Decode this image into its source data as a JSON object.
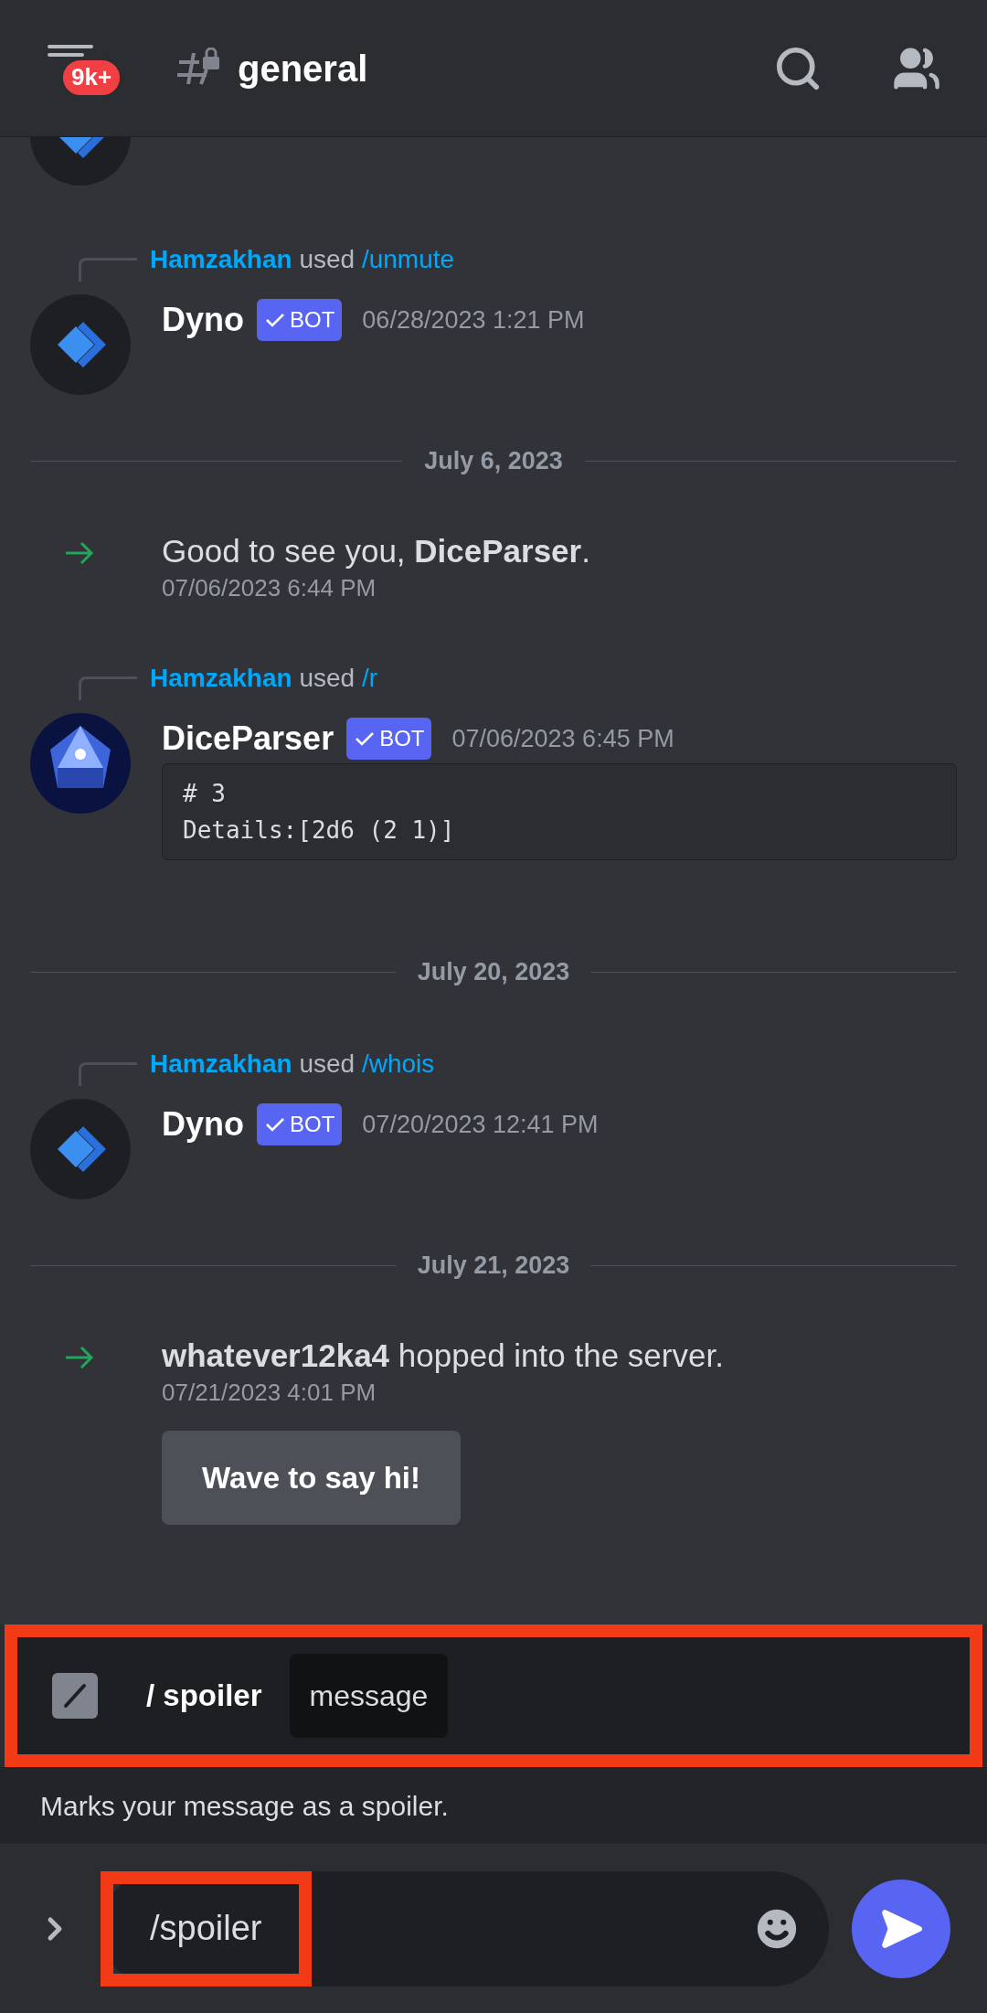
{
  "header": {
    "badge": "9k+",
    "channel": "general"
  },
  "messages": [
    {
      "kind": "cut_avatar",
      "avatar": {
        "kind": "dyno"
      }
    },
    {
      "kind": "command",
      "user": "Hamzakhan",
      "verb": "used",
      "command": "/unmute",
      "author": "Dyno",
      "avatar": {
        "kind": "dyno"
      },
      "tag": "BOT",
      "time": "06/28/2023 1:21 PM"
    },
    {
      "kind": "divider",
      "label": "July 6, 2023"
    },
    {
      "kind": "join",
      "text": "Good to see you, **DiceParser**.",
      "time": "07/06/2023 6:44 PM"
    },
    {
      "kind": "command",
      "user": "Hamzakhan",
      "verb": "used",
      "command": "/r",
      "author": "DiceParser",
      "avatar": {
        "kind": "dice"
      },
      "tag": "BOT",
      "time": "07/06/2023 6:45 PM",
      "code": [
        "# 3",
        "Details:[2d6 (2 1)]"
      ]
    },
    {
      "kind": "divider",
      "label": "July 20, 2023"
    },
    {
      "kind": "command",
      "user": "Hamzakhan",
      "verb": "used",
      "command": "/whois",
      "author": "Dyno",
      "avatar": {
        "kind": "dyno"
      },
      "tag": "BOT",
      "time": "07/20/2023 12:41 PM"
    },
    {
      "kind": "divider",
      "label": "July 21, 2023"
    },
    {
      "kind": "join",
      "text": "**whatever12ka4** hopped into the server.",
      "time": "07/21/2023 4:01 PM",
      "button": "Wave to say hi!"
    }
  ],
  "command_suggestion": {
    "name": "/ spoiler",
    "option": "message",
    "description": "Marks your message as a spoiler."
  },
  "composer": {
    "value": "/spoiler"
  }
}
